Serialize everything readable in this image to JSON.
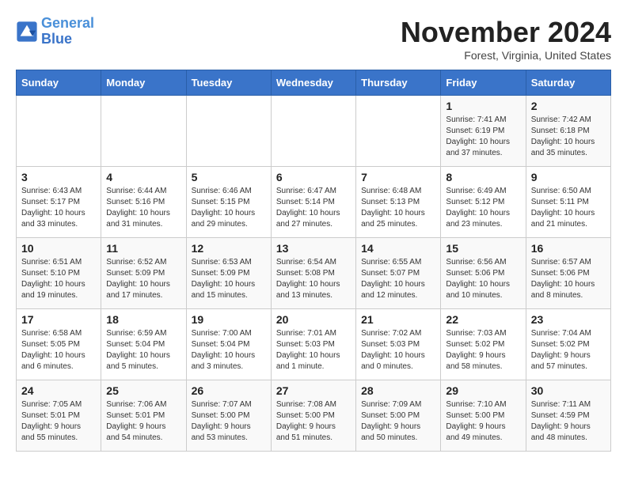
{
  "logo": {
    "line1": "General",
    "line2": "Blue"
  },
  "title": "November 2024",
  "location": "Forest, Virginia, United States",
  "days_of_week": [
    "Sunday",
    "Monday",
    "Tuesday",
    "Wednesday",
    "Thursday",
    "Friday",
    "Saturday"
  ],
  "weeks": [
    [
      {
        "day": "",
        "info": ""
      },
      {
        "day": "",
        "info": ""
      },
      {
        "day": "",
        "info": ""
      },
      {
        "day": "",
        "info": ""
      },
      {
        "day": "",
        "info": ""
      },
      {
        "day": "1",
        "info": "Sunrise: 7:41 AM\nSunset: 6:19 PM\nDaylight: 10 hours and 37 minutes."
      },
      {
        "day": "2",
        "info": "Sunrise: 7:42 AM\nSunset: 6:18 PM\nDaylight: 10 hours and 35 minutes."
      }
    ],
    [
      {
        "day": "3",
        "info": "Sunrise: 6:43 AM\nSunset: 5:17 PM\nDaylight: 10 hours and 33 minutes."
      },
      {
        "day": "4",
        "info": "Sunrise: 6:44 AM\nSunset: 5:16 PM\nDaylight: 10 hours and 31 minutes."
      },
      {
        "day": "5",
        "info": "Sunrise: 6:46 AM\nSunset: 5:15 PM\nDaylight: 10 hours and 29 minutes."
      },
      {
        "day": "6",
        "info": "Sunrise: 6:47 AM\nSunset: 5:14 PM\nDaylight: 10 hours and 27 minutes."
      },
      {
        "day": "7",
        "info": "Sunrise: 6:48 AM\nSunset: 5:13 PM\nDaylight: 10 hours and 25 minutes."
      },
      {
        "day": "8",
        "info": "Sunrise: 6:49 AM\nSunset: 5:12 PM\nDaylight: 10 hours and 23 minutes."
      },
      {
        "day": "9",
        "info": "Sunrise: 6:50 AM\nSunset: 5:11 PM\nDaylight: 10 hours and 21 minutes."
      }
    ],
    [
      {
        "day": "10",
        "info": "Sunrise: 6:51 AM\nSunset: 5:10 PM\nDaylight: 10 hours and 19 minutes."
      },
      {
        "day": "11",
        "info": "Sunrise: 6:52 AM\nSunset: 5:09 PM\nDaylight: 10 hours and 17 minutes."
      },
      {
        "day": "12",
        "info": "Sunrise: 6:53 AM\nSunset: 5:09 PM\nDaylight: 10 hours and 15 minutes."
      },
      {
        "day": "13",
        "info": "Sunrise: 6:54 AM\nSunset: 5:08 PM\nDaylight: 10 hours and 13 minutes."
      },
      {
        "day": "14",
        "info": "Sunrise: 6:55 AM\nSunset: 5:07 PM\nDaylight: 10 hours and 12 minutes."
      },
      {
        "day": "15",
        "info": "Sunrise: 6:56 AM\nSunset: 5:06 PM\nDaylight: 10 hours and 10 minutes."
      },
      {
        "day": "16",
        "info": "Sunrise: 6:57 AM\nSunset: 5:06 PM\nDaylight: 10 hours and 8 minutes."
      }
    ],
    [
      {
        "day": "17",
        "info": "Sunrise: 6:58 AM\nSunset: 5:05 PM\nDaylight: 10 hours and 6 minutes."
      },
      {
        "day": "18",
        "info": "Sunrise: 6:59 AM\nSunset: 5:04 PM\nDaylight: 10 hours and 5 minutes."
      },
      {
        "day": "19",
        "info": "Sunrise: 7:00 AM\nSunset: 5:04 PM\nDaylight: 10 hours and 3 minutes."
      },
      {
        "day": "20",
        "info": "Sunrise: 7:01 AM\nSunset: 5:03 PM\nDaylight: 10 hours and 1 minute."
      },
      {
        "day": "21",
        "info": "Sunrise: 7:02 AM\nSunset: 5:03 PM\nDaylight: 10 hours and 0 minutes."
      },
      {
        "day": "22",
        "info": "Sunrise: 7:03 AM\nSunset: 5:02 PM\nDaylight: 9 hours and 58 minutes."
      },
      {
        "day": "23",
        "info": "Sunrise: 7:04 AM\nSunset: 5:02 PM\nDaylight: 9 hours and 57 minutes."
      }
    ],
    [
      {
        "day": "24",
        "info": "Sunrise: 7:05 AM\nSunset: 5:01 PM\nDaylight: 9 hours and 55 minutes."
      },
      {
        "day": "25",
        "info": "Sunrise: 7:06 AM\nSunset: 5:01 PM\nDaylight: 9 hours and 54 minutes."
      },
      {
        "day": "26",
        "info": "Sunrise: 7:07 AM\nSunset: 5:00 PM\nDaylight: 9 hours and 53 minutes."
      },
      {
        "day": "27",
        "info": "Sunrise: 7:08 AM\nSunset: 5:00 PM\nDaylight: 9 hours and 51 minutes."
      },
      {
        "day": "28",
        "info": "Sunrise: 7:09 AM\nSunset: 5:00 PM\nDaylight: 9 hours and 50 minutes."
      },
      {
        "day": "29",
        "info": "Sunrise: 7:10 AM\nSunset: 5:00 PM\nDaylight: 9 hours and 49 minutes."
      },
      {
        "day": "30",
        "info": "Sunrise: 7:11 AM\nSunset: 4:59 PM\nDaylight: 9 hours and 48 minutes."
      }
    ]
  ]
}
